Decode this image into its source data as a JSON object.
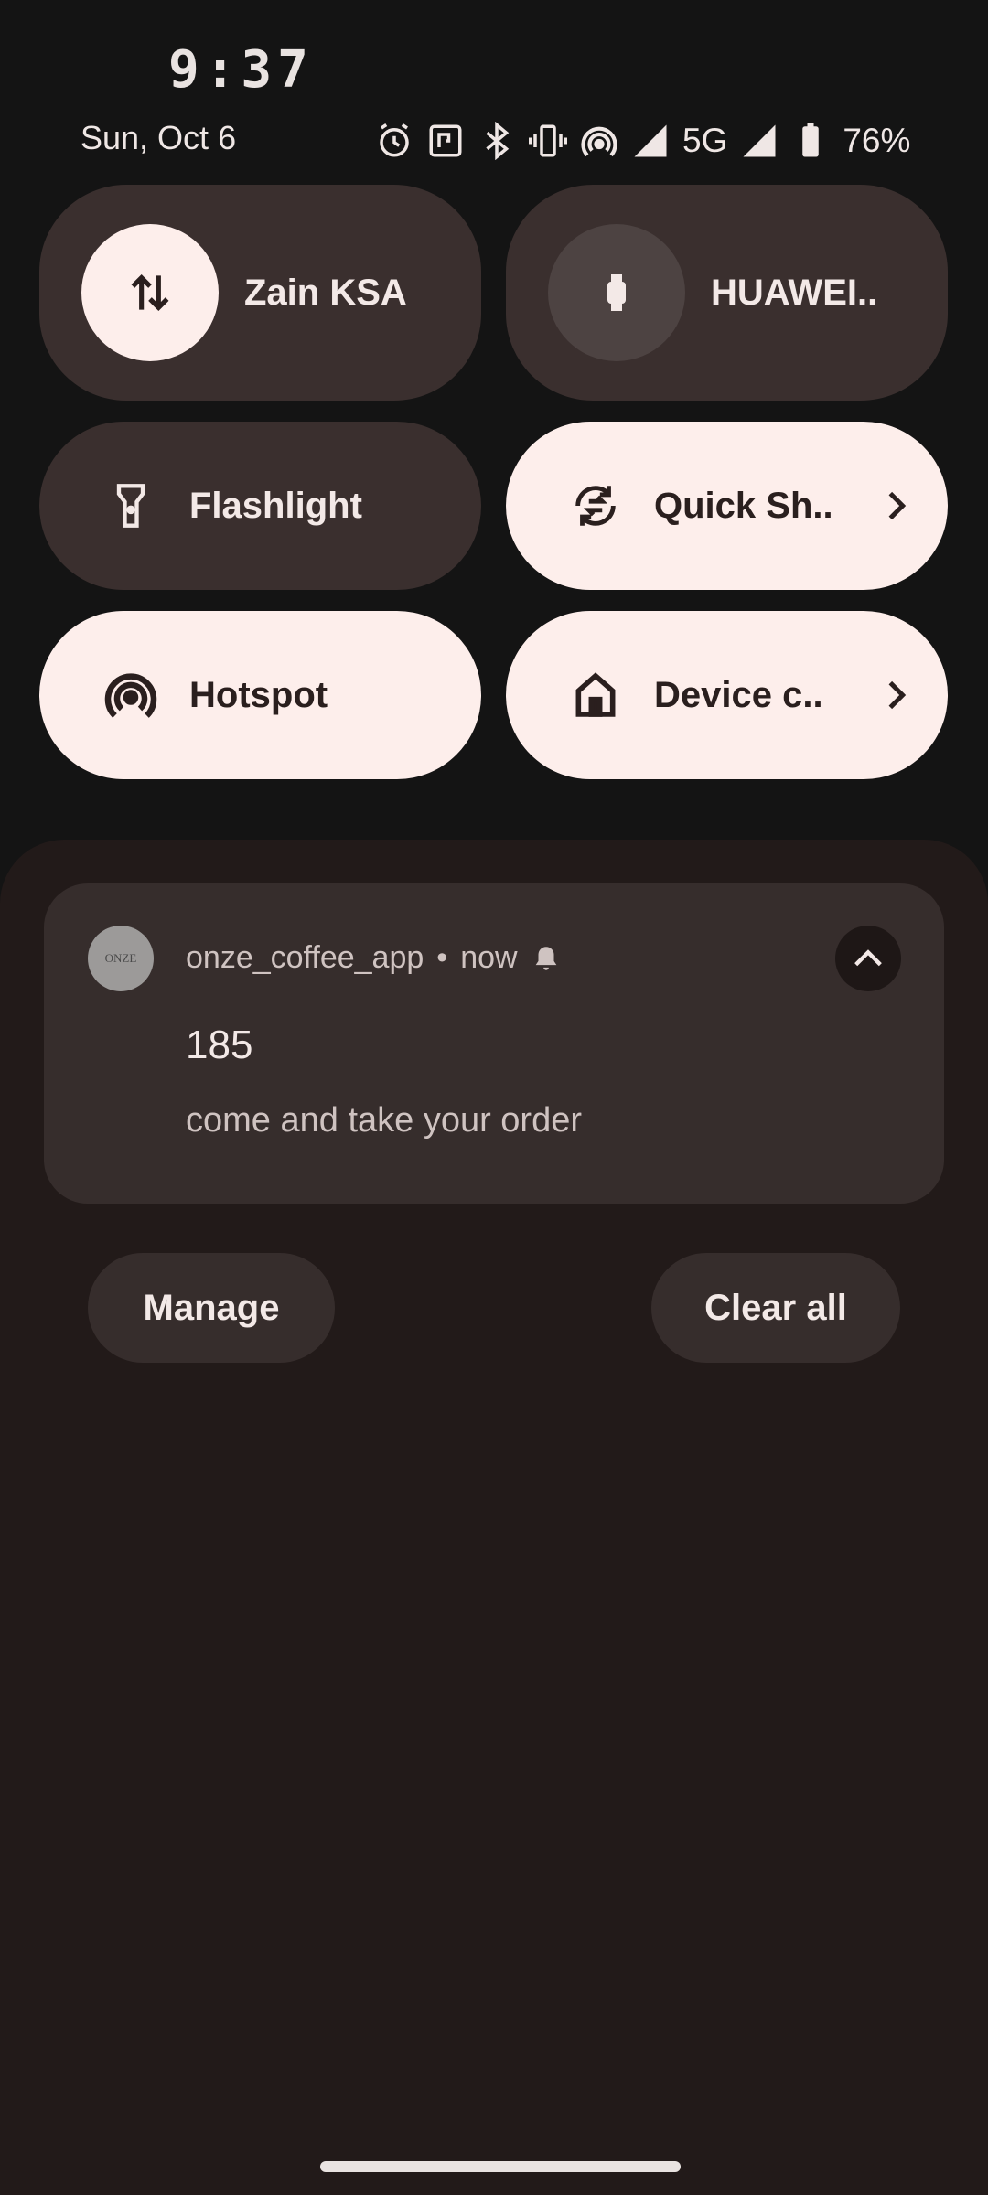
{
  "status": {
    "time": "9:37",
    "date": "Sun, Oct 6",
    "network": "5G",
    "battery": "76%"
  },
  "quick_settings": {
    "tiles": [
      {
        "label": "Zain KSA",
        "icon": "mobile-data-icon",
        "state": "on"
      },
      {
        "label": "HUAWEI..",
        "icon": "watch-icon",
        "state": "off"
      },
      {
        "label": "Flashlight",
        "icon": "flashlight-icon",
        "state": "off"
      },
      {
        "label": "Quick Sh..",
        "icon": "quick-share-icon",
        "state": "on"
      },
      {
        "label": "Hotspot",
        "icon": "hotspot-icon",
        "state": "on"
      },
      {
        "label": "Device c..",
        "icon": "home-icon",
        "state": "on"
      }
    ]
  },
  "notification": {
    "app_icon_text": "ONZE",
    "app_name": "onze_coffee_app",
    "separator": "•",
    "time": "now",
    "title": "185",
    "text": "come and take your order"
  },
  "actions": {
    "manage": "Manage",
    "clear_all": "Clear all"
  },
  "colors": {
    "tile_on": "#fdeeeb",
    "tile_off": "#3a2f2e",
    "shade_bg": "#221a19",
    "card_bg": "#362d2c"
  }
}
